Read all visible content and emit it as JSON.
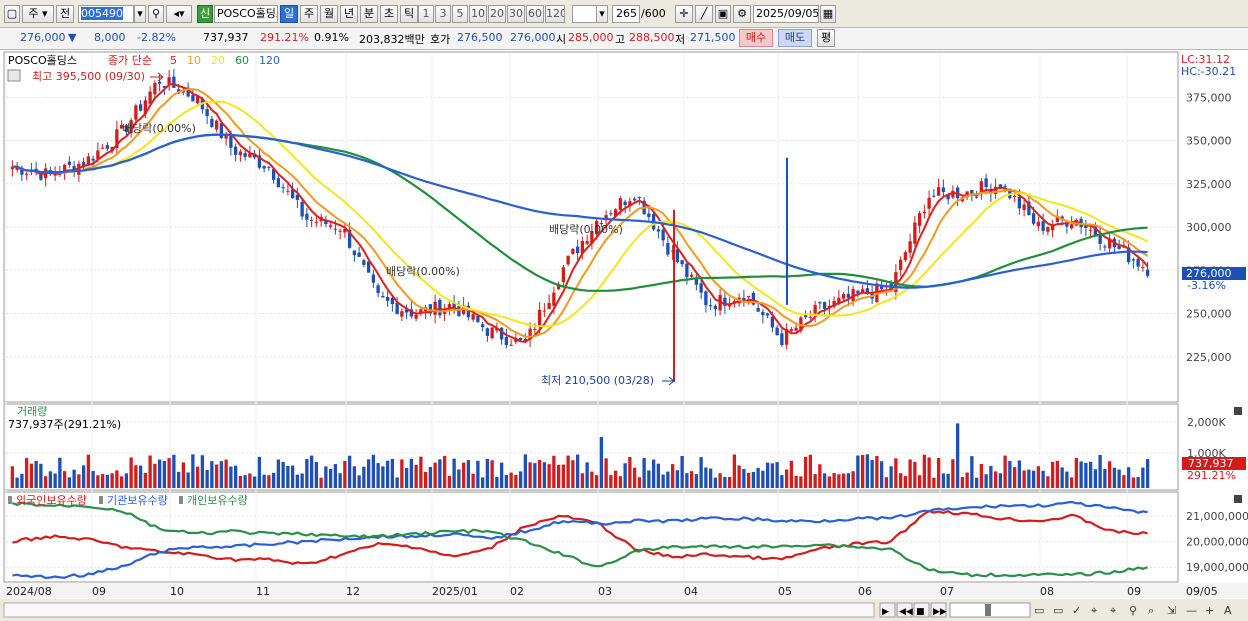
{
  "toolbar": {
    "freq_dropdown": "주",
    "prev_label": "전",
    "code_value": "005490",
    "sin_badge": "신",
    "stock_name": "POSCO홀딩스",
    "periods": [
      "일",
      "주",
      "월",
      "년",
      "분",
      "초",
      "틱"
    ],
    "intervals": [
      "1",
      "3",
      "5",
      "10",
      "20",
      "30",
      "60",
      "120"
    ],
    "count_value": "265",
    "count_total": "/600",
    "date_value": "2025/09/05"
  },
  "quote": {
    "price": "276,000",
    "change": "8,000",
    "change_pct": "-2.82%",
    "volume": "737,937",
    "volume_pct": "291.21%",
    "turnover_pct": "0.91%",
    "amount": "203,832백만",
    "ask_label": "호가",
    "ask1": "276,500",
    "ask2": "276,000",
    "open_label": "시",
    "open": "285,000",
    "high_label": "고",
    "high": "288,500",
    "low_label": "저",
    "low": "271,500",
    "buy_label": "매수",
    "sell_label": "매도",
    "eval_label": "평"
  },
  "price_panel": {
    "legend_name": "POSCO홀딩스",
    "legend_ma": "종가 단순",
    "ma_periods": [
      {
        "label": "5",
        "color": "#e21d1d"
      },
      {
        "label": "10",
        "color": "#f39a1d"
      },
      {
        "label": "20",
        "color": "#f4e61b"
      },
      {
        "label": "60",
        "color": "#1f8f3a"
      },
      {
        "label": "120",
        "color": "#2a5fd6"
      }
    ],
    "lc": "LC:31.12",
    "hc": "HC:-30.21",
    "high_marker": "최고 395,500 (09/30)",
    "low_marker": "최저 210,500 (03/28)",
    "dividend_labels": [
      "배당락(0.00%)",
      "배당락(0.00%)",
      "배당락(0.00%)"
    ],
    "current_price_label": "276,000",
    "current_pct_label": "-3.16%"
  },
  "volume_panel": {
    "title": "거래량",
    "value_label": "737,937주(291.21%)",
    "current_label": "737,937",
    "current_pct": "291.21%"
  },
  "holdings_panel": {
    "legend": [
      {
        "label": "외국인보유수량",
        "color": "#d21d1d"
      },
      {
        "label": "기관보유수량",
        "color": "#2a5fd6"
      },
      {
        "label": "개인보유수량",
        "color": "#2b8f4a"
      }
    ]
  },
  "x_axis_labels": [
    "2024/08",
    "09",
    "10",
    "11",
    "12",
    "2025/01",
    "02",
    "03",
    "04",
    "05",
    "06",
    "07",
    "08",
    "09",
    "09/05"
  ],
  "chart_data": [
    {
      "type": "candlestick",
      "title": "POSCO홀딩스 종가 단순 5 10 20 60 120",
      "frequency": "weekly-view daily candles",
      "ylim": [
        200000,
        400000
      ],
      "y_ticks": [
        "375,000",
        "350,000",
        "325,000",
        "300,000",
        "275,000",
        "250,000",
        "225,000"
      ],
      "x_ticks": [
        "2024/08",
        "09",
        "10",
        "11",
        "12",
        "2025/01",
        "02",
        "03",
        "04",
        "05",
        "06",
        "07",
        "08",
        "09"
      ],
      "close_path": [
        [
          "2024/08",
          335000
        ],
        [
          "mid-08",
          330000
        ],
        [
          "09",
          338000
        ],
        [
          "mid-09",
          355000
        ],
        [
          "09/30",
          385000
        ],
        [
          "10",
          375000
        ],
        [
          "mid-10",
          345000
        ],
        [
          "11",
          335000
        ],
        [
          "mid-11",
          305000
        ],
        [
          "12",
          300000
        ],
        [
          "mid-12",
          258000
        ],
        [
          "2025/01",
          250000
        ],
        [
          "mid-01",
          255000
        ],
        [
          "02",
          240000
        ],
        [
          "mid-02",
          232000
        ],
        [
          "late-02",
          275000
        ],
        [
          "03",
          305000
        ],
        [
          "mid-03",
          320000
        ],
        [
          "04",
          285000
        ],
        [
          "mid-04",
          255000
        ],
        [
          "05",
          262000
        ],
        [
          "mid-05",
          235000
        ],
        [
          "06",
          252000
        ],
        [
          "mid-06",
          260000
        ],
        [
          "07",
          265000
        ],
        [
          "early-07",
          318000
        ],
        [
          "mid-07",
          320000
        ],
        [
          "late-07",
          325000
        ],
        [
          "08",
          300000
        ],
        [
          "mid-08",
          305000
        ],
        [
          "late-08",
          290000
        ],
        [
          "09/05",
          276000
        ]
      ],
      "annotations": [
        {
          "text": "최고 395,500 (09/30)",
          "value": 395500
        },
        {
          "text": "최저 210,500 (03/28)",
          "value": 210500
        }
      ]
    },
    {
      "type": "bar",
      "title": "거래량",
      "y_ticks": [
        "2,000K",
        "1,000K"
      ],
      "last_value": 737937,
      "last_pct": "291.21%"
    },
    {
      "type": "line",
      "title": "외국인보유수량 기관보유수량 개인보유수량",
      "y_ticks": [
        "21,000,000",
        "20,000,000",
        "19,000,000"
      ],
      "ylim": [
        18500000,
        21700000
      ],
      "series": [
        {
          "name": "외국인보유수량",
          "color": "#d21d1d"
        },
        {
          "name": "기관보유수량",
          "color": "#2a5fd6"
        },
        {
          "name": "개인보유수량",
          "color": "#2b8f4a"
        }
      ]
    }
  ]
}
